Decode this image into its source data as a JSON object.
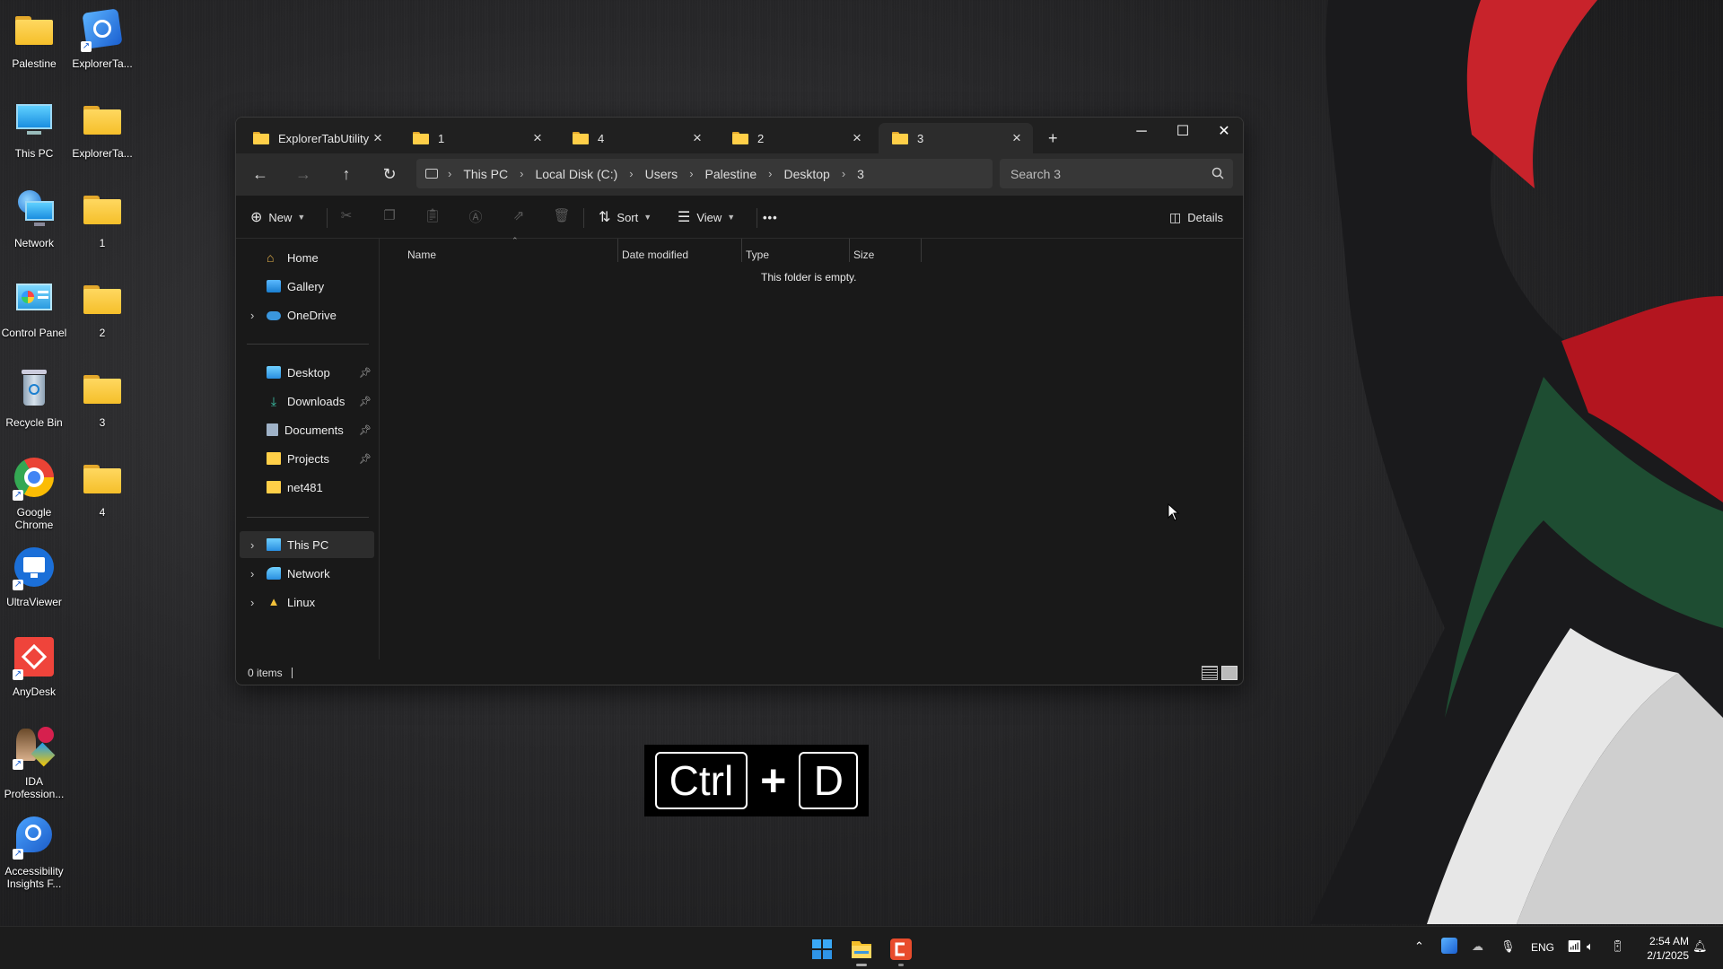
{
  "desktop": {
    "icons": [
      {
        "label": "Palestine",
        "icon": "folder-icon"
      },
      {
        "label": "ExplorerTa...",
        "icon": "explorertab-shortcut-icon"
      },
      {
        "label": "This PC",
        "icon": "monitor-icon"
      },
      {
        "label": "ExplorerTa...",
        "icon": "folder-icon"
      },
      {
        "label": "Network",
        "icon": "network-icon"
      },
      {
        "label": "1",
        "icon": "folder-icon"
      },
      {
        "label": "Control Panel",
        "icon": "control-panel-icon"
      },
      {
        "label": "2",
        "icon": "folder-icon"
      },
      {
        "label": "Recycle Bin",
        "icon": "recycle-bin-icon"
      },
      {
        "label": "3",
        "icon": "folder-icon"
      },
      {
        "label": "Google Chrome",
        "icon": "chrome-icon"
      },
      {
        "label": "4",
        "icon": "folder-icon"
      },
      {
        "label": "UltraViewer",
        "icon": "ultraviewer-icon"
      },
      {
        "label": "AnyDesk",
        "icon": "anydesk-icon"
      },
      {
        "label": "IDA Profession...",
        "icon": "ida-icon"
      },
      {
        "label": "Accessibility Insights F...",
        "icon": "accessibility-insights-icon"
      }
    ]
  },
  "explorer": {
    "tabs": [
      {
        "label": "ExplorerTabUtility"
      },
      {
        "label": "1"
      },
      {
        "label": "4"
      },
      {
        "label": "2"
      },
      {
        "label": "3",
        "active": true
      }
    ],
    "new_tab": "+",
    "address": [
      "This PC",
      "Local Disk (C:)",
      "Users",
      "Palestine",
      "Desktop",
      "3"
    ],
    "search_placeholder": "Search 3",
    "toolbar": {
      "new": "New",
      "sort": "Sort",
      "view": "View",
      "more": "•••",
      "details": "Details"
    },
    "nav": {
      "top": [
        {
          "label": "Home",
          "icon": "home-icon"
        },
        {
          "label": "Gallery",
          "icon": "gallery-icon"
        },
        {
          "label": "OneDrive",
          "icon": "onedrive-icon"
        }
      ],
      "quick": [
        {
          "label": "Desktop",
          "icon": "desktop-icon",
          "pinned": true
        },
        {
          "label": "Downloads",
          "icon": "downloads-icon",
          "pinned": true
        },
        {
          "label": "Documents",
          "icon": "documents-icon",
          "pinned": true
        },
        {
          "label": "Projects",
          "icon": "folder-icon",
          "pinned": true
        },
        {
          "label": "net481",
          "icon": "folder-icon",
          "pinned": false
        }
      ],
      "locations": [
        {
          "label": "This PC",
          "icon": "this-pc-icon",
          "selected": true
        },
        {
          "label": "Network",
          "icon": "network-icon"
        },
        {
          "label": "Linux",
          "icon": "linux-icon"
        }
      ]
    },
    "columns": [
      "Name",
      "Date modified",
      "Type",
      "Size"
    ],
    "empty_message": "This folder is empty.",
    "status": "0 items"
  },
  "key_overlay": {
    "key1": "Ctrl",
    "plus": "+",
    "key2": "D"
  },
  "taskbar": {
    "tray": {
      "language": "ENG",
      "time": "2:54 AM",
      "date": "2/1/2025"
    }
  },
  "colors": {
    "folder": "#ffcf48",
    "window_bg": "#191919",
    "accent": "#0078d4"
  }
}
